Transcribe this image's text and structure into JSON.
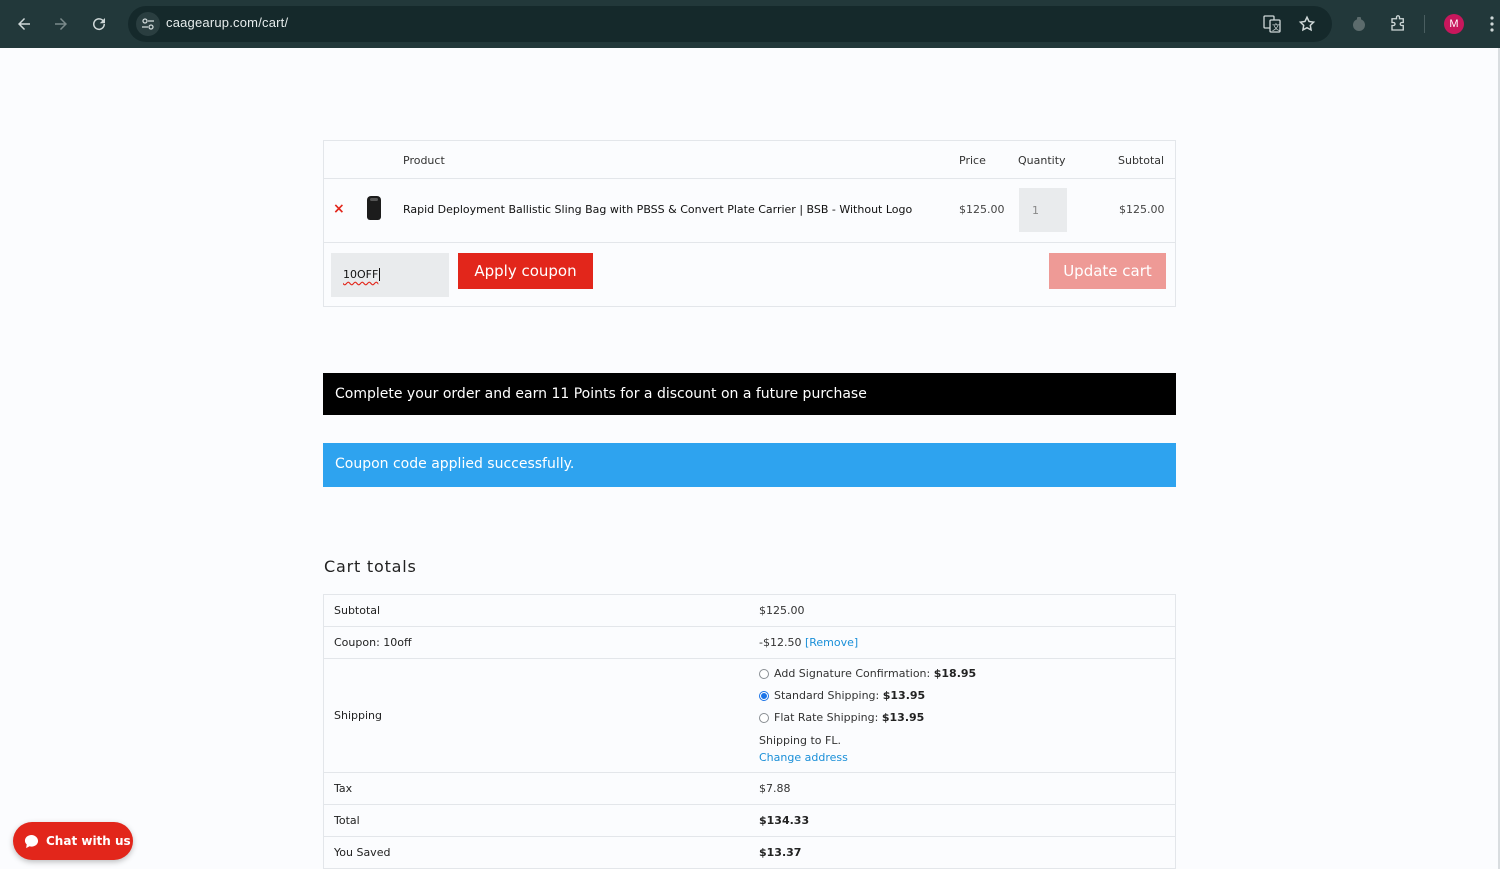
{
  "browser": {
    "url": "caagearup.com/cart/",
    "profile_initial": "M",
    "icons": [
      "back-icon",
      "forward-icon",
      "reload-icon",
      "site-info-icon",
      "translate-icon",
      "bookmark-star-icon",
      "extension-icon",
      "puzzle-icon",
      "menu-dots-icon"
    ]
  },
  "cart": {
    "headers": {
      "product": "Product",
      "price": "Price",
      "quantity": "Quantity",
      "subtotal": "Subtotal"
    },
    "items": [
      {
        "remove": "×",
        "name": "Rapid Deployment Ballistic Sling Bag with PBSS & Convert Plate Carrier | BSB - Without Logo",
        "price": "$125.00",
        "quantity": "1",
        "subtotal": "$125.00"
      }
    ],
    "coupon_value": "10OFF",
    "apply_label": "Apply coupon",
    "update_label": "Update cart"
  },
  "notices": {
    "points": "Complete your order and earn 11 Points for a discount on a future purchase",
    "success": "Coupon code applied successfully."
  },
  "totals": {
    "title": "Cart totals",
    "subtotal_label": "Subtotal",
    "subtotal_value": "$125.00",
    "coupon_label": "Coupon: 10off",
    "coupon_value": "-$12.50",
    "coupon_remove": "[Remove]",
    "shipping_label": "Shipping",
    "shipping_options": [
      {
        "label": "Add Signature Confirmation:",
        "price": "$18.95",
        "checked": false
      },
      {
        "label": "Standard Shipping:",
        "price": "$13.95",
        "checked": true
      },
      {
        "label": "Flat Rate Shipping:",
        "price": "$13.95",
        "checked": false
      }
    ],
    "shipping_to": "Shipping to FL.",
    "change_address": "Change address",
    "tax_label": "Tax",
    "tax_value": "$7.88",
    "total_label": "Total",
    "total_value": "$134.33",
    "saved_label": "You Saved",
    "saved_value": "$13.37"
  },
  "chat": {
    "label": "Chat with us"
  },
  "colors": {
    "accent": "#e2261b",
    "success": "#2ea3ef",
    "link": "#1a8fd8",
    "chrome": "#22383a"
  }
}
